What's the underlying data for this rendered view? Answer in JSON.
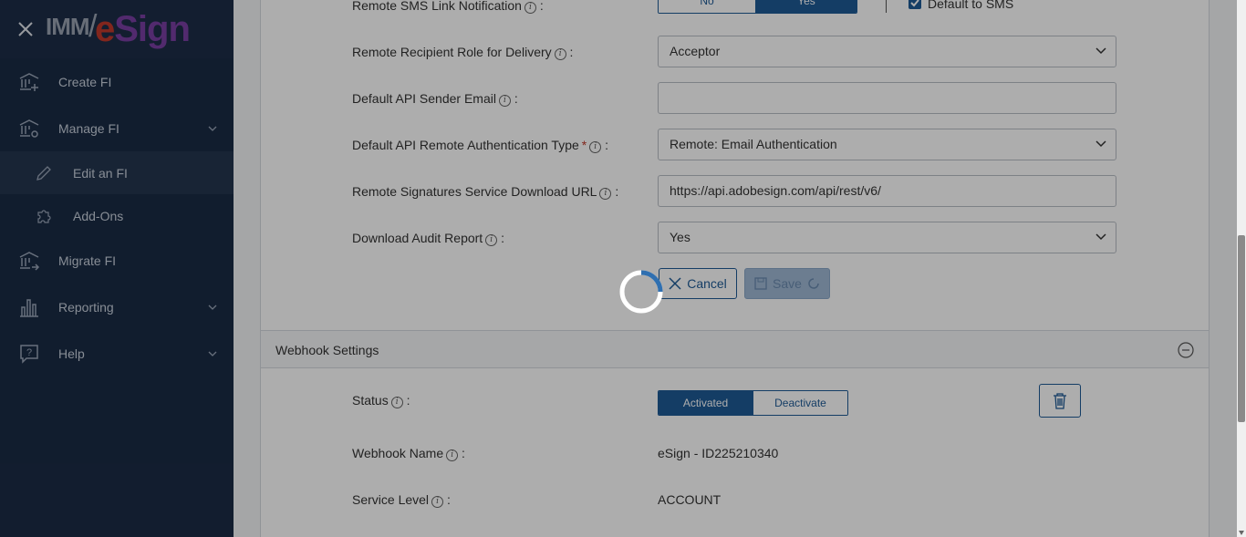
{
  "sidebar": {
    "logo": {
      "prefix": "IMM",
      "e": "e",
      "sign": "Sign"
    },
    "items": [
      {
        "label": "Create FI"
      },
      {
        "label": "Manage FI"
      },
      {
        "label": "Edit an FI"
      },
      {
        "label": "Add-Ons"
      },
      {
        "label": "Migrate FI"
      },
      {
        "label": "Reporting"
      },
      {
        "label": "Help"
      }
    ]
  },
  "form": {
    "sms_label": "Remote SMS Link Notification",
    "sms_no": "No",
    "sms_yes": "Yes",
    "sms_default_label": "Default to SMS",
    "role_label": "Remote Recipient Role for Delivery",
    "role_value": "Acceptor",
    "sender_email_label": "Default API Sender Email",
    "sender_email_value": "",
    "auth_label": "Default API Remote Authentication Type",
    "auth_required": "*",
    "auth_value": "Remote: Email Authentication",
    "url_label": "Remote Signatures Service Download URL",
    "url_value": "https://api.adobesign.com/api/rest/v6/",
    "audit_label": "Download Audit Report",
    "audit_value": "Yes",
    "colon": ":",
    "info_glyph": "i",
    "cancel_label": "Cancel",
    "save_label": "Save"
  },
  "webhook": {
    "title": "Webhook Settings",
    "status_label": "Status",
    "activated": "Activated",
    "deactivate": "Deactivate",
    "name_label": "Webhook Name",
    "name_value": "eSign - ID225210340",
    "service_label": "Service Level",
    "service_value": "ACCOUNT"
  },
  "colors": {
    "sidebar": "#1a2b45",
    "accent": "#1e5a96",
    "overlay": "rgba(0,0,0,0.32)"
  }
}
